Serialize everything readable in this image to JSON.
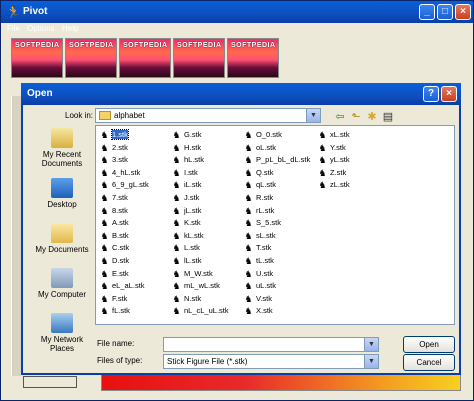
{
  "app": {
    "title": "Pivot",
    "menu": [
      "File",
      "Options",
      "Help"
    ],
    "thumb_watermark": "SOFTPEDIA",
    "thumbnails_count": 5
  },
  "dialog": {
    "title": "Open",
    "look_in_label": "Look in:",
    "look_in_value": "alphabet",
    "places": [
      "My Recent Documents",
      "Desktop",
      "My Documents",
      "My Computer",
      "My Network Places"
    ],
    "files": [
      [
        "1.stk",
        "G.stk",
        "O_0.stk",
        "xL.stk"
      ],
      [
        "2.stk",
        "H.stk",
        "oL.stk",
        "Y.stk"
      ],
      [
        "3.stk",
        "hL.stk",
        "P_pL_bL_dL.stk",
        "yL.stk"
      ],
      [
        "4_hL.stk",
        "I.stk",
        "Q.stk",
        "Z.stk"
      ],
      [
        "6_9_gL.stk",
        "iL.stk",
        "qL.stk",
        "zL.stk"
      ],
      [
        "7.stk",
        "J.stk",
        "R.stk",
        ""
      ],
      [
        "8.stk",
        "jL.stk",
        "rL.stk",
        ""
      ],
      [
        "A.stk",
        "K.stk",
        "S_5.stk",
        ""
      ],
      [
        "B.stk",
        "kL.stk",
        "sL.stk",
        ""
      ],
      [
        "C.stk",
        "L.stk",
        "T.stk",
        ""
      ],
      [
        "D.stk",
        "lL.stk",
        "tL.stk",
        ""
      ],
      [
        "E.stk",
        "M_W.stk",
        "U.stk",
        ""
      ],
      [
        "eL_aL.stk",
        "mL_wL.stk",
        "uL.stk",
        ""
      ],
      [
        "F.stk",
        "N.stk",
        "V.stk",
        ""
      ],
      [
        "fL.stk",
        "nL_cL_uL.stk",
        "X.stk",
        ""
      ]
    ],
    "selected_file": "1.stk",
    "file_name_label": "File name:",
    "file_name_value": "",
    "file_type_label": "Files of type:",
    "file_type_value": "Stick Figure File (*.stk)",
    "open_label": "Open",
    "cancel_label": "Cancel"
  }
}
